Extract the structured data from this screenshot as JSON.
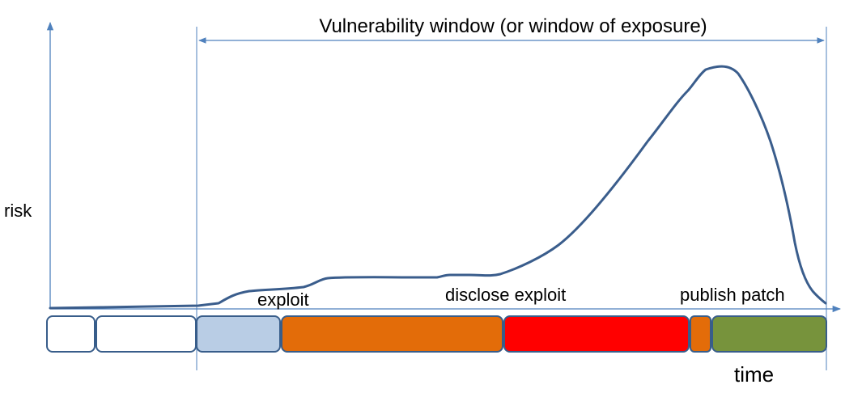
{
  "labels": {
    "window_title": "Vulnerability window (or window of exposure)",
    "y_axis": "risk",
    "x_axis": "time",
    "exploit": "exploit",
    "disclose": "disclose exploit",
    "publish": "publish patch"
  },
  "phases": [
    {
      "fill": "#ffffff"
    },
    {
      "fill": "#ffffff"
    },
    {
      "fill": "#b9cde5"
    },
    {
      "fill": "#e36c09"
    },
    {
      "fill": "#ff0000"
    },
    {
      "fill": "#e36c09"
    },
    {
      "fill": "#77933c"
    }
  ],
  "colors": {
    "axis": "#4f81bd",
    "curve": "#3a5d8c",
    "phase_border": "#385d8a"
  }
}
